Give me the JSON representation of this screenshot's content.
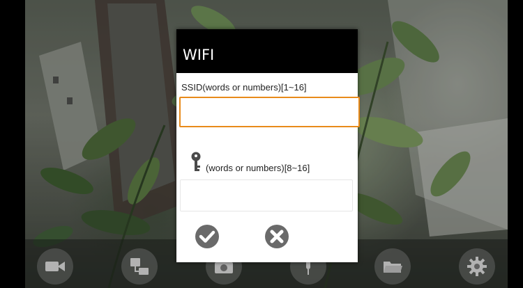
{
  "dialog": {
    "title": "WIFI",
    "ssid_label": "SSID(words or numbers)[1~16]",
    "ssid_value": "",
    "password_icon": "key-icon",
    "password_label": "(words or numbers)[8~16]",
    "password_value": "",
    "confirm_icon": "check-circle-icon",
    "cancel_icon": "close-circle-icon"
  },
  "toolbar": {
    "items": [
      {
        "icon": "video-camera-icon"
      },
      {
        "icon": "network-icon"
      },
      {
        "icon": "camera-snapshot-icon"
      },
      {
        "icon": "microphone-icon"
      },
      {
        "icon": "folder-icon"
      },
      {
        "icon": "settings-gear-icon"
      }
    ]
  },
  "colors": {
    "accent_focus": "#e88a1a",
    "dialog_header": "#000000",
    "dialog_body": "#ffffff",
    "icon_gray": "#6a6a6a"
  }
}
